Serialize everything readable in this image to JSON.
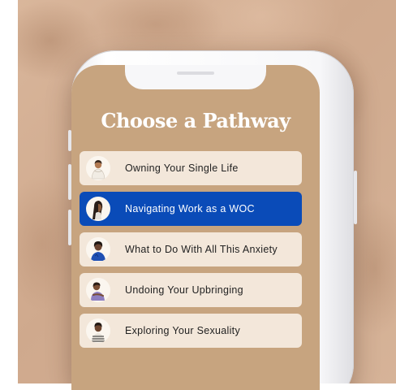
{
  "screen": {
    "title": "Choose a Pathway",
    "pathways": [
      {
        "label": "Owning Your Single Life",
        "icon": "woman-wrapped-in-scarf-icon",
        "selected": false
      },
      {
        "label": "Navigating Work as a WOC",
        "icon": "woman-in-profile-icon",
        "selected": true
      },
      {
        "label": "What to Do With All This Anxiety",
        "icon": "woman-in-blue-sweater-icon",
        "selected": false
      },
      {
        "label": "Undoing Your Upbringing",
        "icon": "woman-hugging-self-icon",
        "selected": false
      },
      {
        "label": "Exploring Your Sexuality",
        "icon": "woman-in-striped-top-icon",
        "selected": false
      }
    ]
  },
  "colors": {
    "screen_background": "#c7a47f",
    "item_background": "#f3e7da",
    "selected_item": "#0a4bb8",
    "title_text": "#ffffff"
  }
}
